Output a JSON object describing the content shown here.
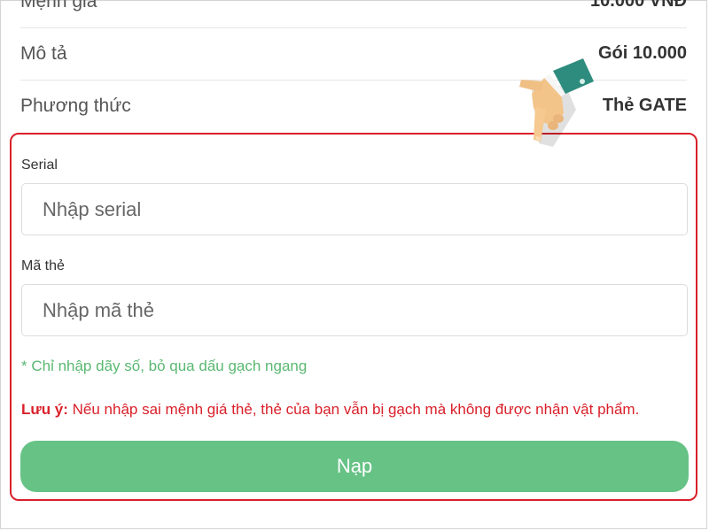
{
  "info": {
    "denomination_label": "Mệnh giá",
    "denomination_value": "10.000 VNĐ",
    "description_label": "Mô tả",
    "description_value": "Gói 10.000",
    "method_label": "Phương thức",
    "method_value": "Thẻ GATE"
  },
  "form": {
    "serial_label": "Serial",
    "serial_placeholder": "Nhập serial",
    "serial_value": "",
    "code_label": "Mã thẻ",
    "code_placeholder": "Nhập mã thẻ",
    "code_value": "",
    "hint": "* Chỉ nhập dãy số, bỏ qua dấu gạch ngang",
    "note_prefix": "Lưu ý:",
    "note_text": " Nếu nhập sai mệnh giá thẻ, thẻ của bạn vẫn bị gạch mà không được nhận vật phẩm.",
    "submit_label": "Nạp"
  },
  "colors": {
    "highlight_border": "#d9202a",
    "submit_button": "#66c285",
    "hint_text": "#5bb872",
    "warning_text": "#d9202a"
  },
  "icons": {
    "pointer": "pointing-hand-icon"
  }
}
